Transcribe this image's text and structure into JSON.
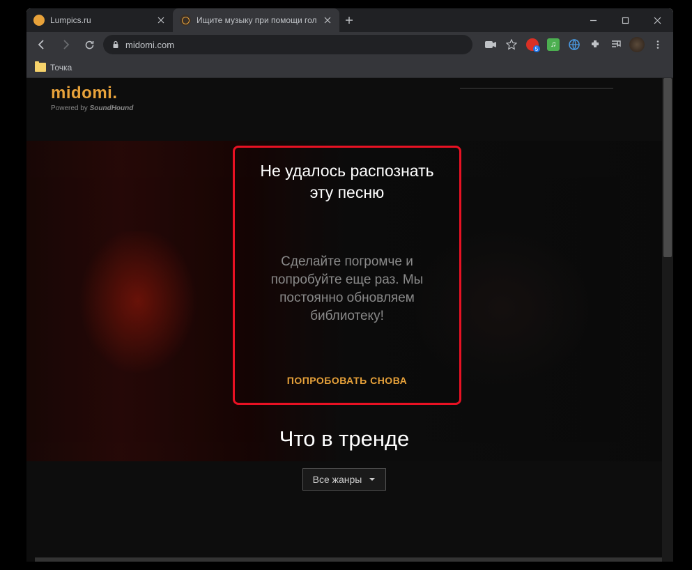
{
  "tabs": [
    {
      "title": "Lumpics.ru"
    },
    {
      "title": "Ищите музыку при помощи гол"
    }
  ],
  "url": "midomi.com",
  "bookmark": {
    "label": "Точка"
  },
  "logo": {
    "name": "midomi",
    "sub_prefix": "Powered by ",
    "sub_brand": "SoundHound"
  },
  "dialog": {
    "title": "Не удалось распознать эту песню",
    "body": "Сделайте погромче и попробуйте еще раз. Мы постоянно обновляем библиотеку!",
    "retry": "ПОПРОБОВАТЬ СНОВА"
  },
  "trending": {
    "heading": "Что в тренде",
    "genre": "Все жанры"
  },
  "ext_badge": "5"
}
